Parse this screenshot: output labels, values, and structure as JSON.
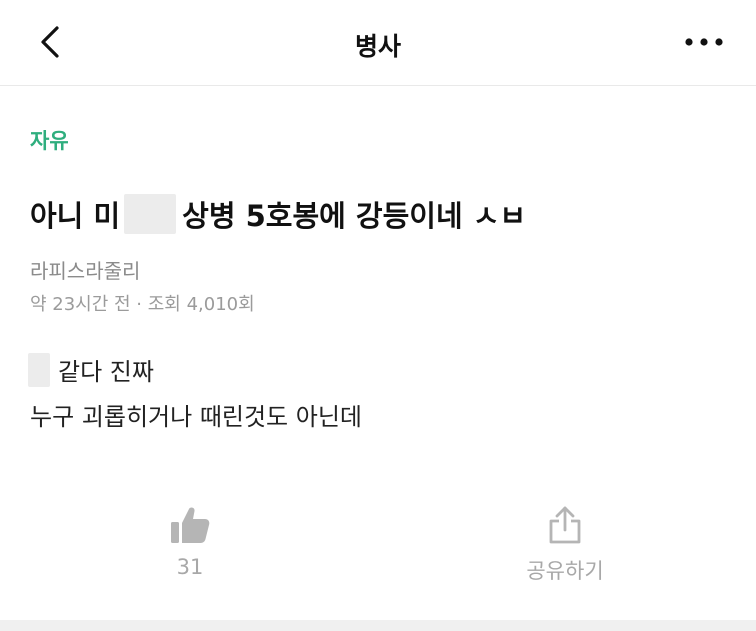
{
  "header": {
    "title": "병사",
    "back_icon": "chevron-left-icon",
    "more_icon": "more-horizontal-icon"
  },
  "post": {
    "category": "자유",
    "title_part1": "아니 미",
    "title_part2": "상병 5호봉에 강등이네 ㅅㅂ",
    "author": "라피스라줄리",
    "meta": "약 23시간 전 · 조회 4,010회",
    "body_line1": "같다 진짜",
    "body_line2": "누구 괴롭히거나 때린것도 아닌데"
  },
  "actions": {
    "like_count": "31",
    "like_icon": "thumbs-up-icon",
    "share_label": "공유하기",
    "share_icon": "share-icon"
  },
  "colors": {
    "category": "#2fae7e",
    "muted": "#9b9b9b",
    "icon": "#b5b5b5"
  }
}
